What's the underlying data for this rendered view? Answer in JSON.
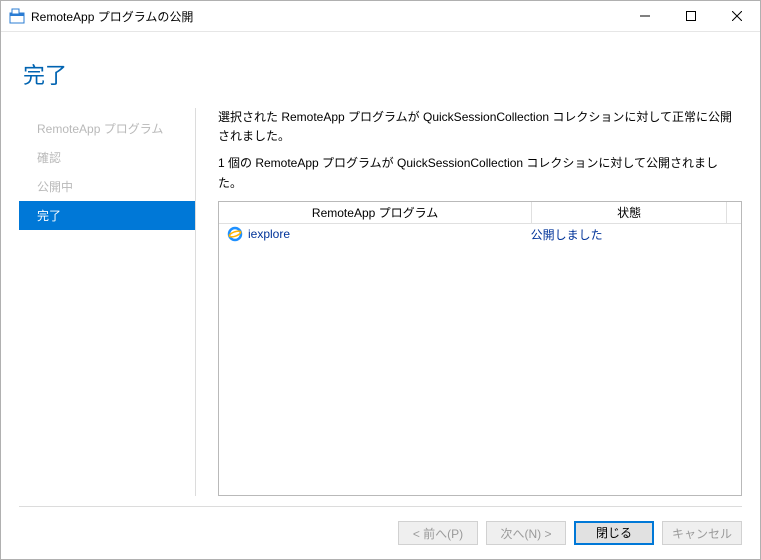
{
  "window": {
    "title": "RemoteApp プログラムの公開"
  },
  "page": {
    "heading": "完了"
  },
  "sidebar": {
    "items": [
      {
        "label": "RemoteApp プログラム"
      },
      {
        "label": "確認"
      },
      {
        "label": "公開中"
      },
      {
        "label": "完了"
      }
    ]
  },
  "main": {
    "msg1": "選択された RemoteApp プログラムが QuickSessionCollection コレクションに対して正常に公開されました。",
    "msg2": "1 個の RemoteApp プログラムが QuickSessionCollection コレクションに対して公開されました。",
    "headers": {
      "col1": "RemoteApp プログラム",
      "col2": "状態"
    },
    "rows": [
      {
        "name": "iexplore",
        "state": "公開しました"
      }
    ]
  },
  "buttons": {
    "prev": "< 前へ(P)",
    "next": "次へ(N) >",
    "close": "閉じる",
    "cancel": "キャンセル"
  }
}
